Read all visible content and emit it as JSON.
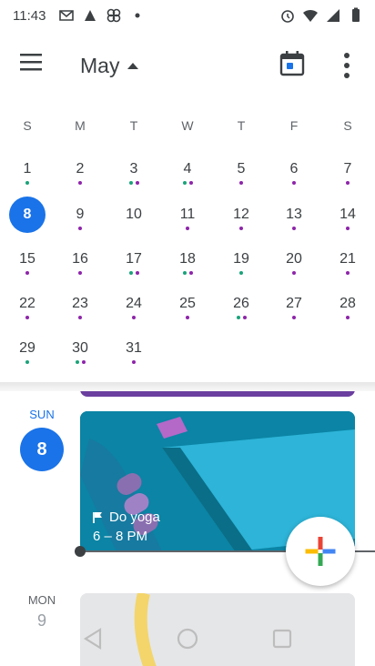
{
  "status_bar": {
    "time": "11:43",
    "left_icons": [
      "gmail-icon",
      "photos-icon",
      "pinwheel-icon",
      "dot-icon"
    ],
    "right_icons": [
      "alarm-icon",
      "wifi-icon",
      "signal-icon",
      "battery-icon"
    ]
  },
  "app_bar": {
    "month_label": "May",
    "menu_icon": "hamburger-menu-icon",
    "today_icon": "calendar-today-icon",
    "more_icon": "more-vert-icon"
  },
  "calendar": {
    "weekdays": [
      "S",
      "M",
      "T",
      "W",
      "T",
      "F",
      "S"
    ],
    "selected_day": "8",
    "weeks": [
      [
        {
          "n": "1",
          "dots": "g"
        },
        {
          "n": "2",
          "dots": "p"
        },
        {
          "n": "3",
          "dots": "gp"
        },
        {
          "n": "4",
          "dots": "gp"
        },
        {
          "n": "5",
          "dots": "p"
        },
        {
          "n": "6",
          "dots": "p"
        },
        {
          "n": "7",
          "dots": "p"
        }
      ],
      [
        {
          "n": "8",
          "dots": ""
        },
        {
          "n": "9",
          "dots": "p"
        },
        {
          "n": "10",
          "dots": ""
        },
        {
          "n": "11",
          "dots": "p"
        },
        {
          "n": "12",
          "dots": "p"
        },
        {
          "n": "13",
          "dots": "p"
        },
        {
          "n": "14",
          "dots": "p"
        }
      ],
      [
        {
          "n": "15",
          "dots": "p"
        },
        {
          "n": "16",
          "dots": "p"
        },
        {
          "n": "17",
          "dots": "gp"
        },
        {
          "n": "18",
          "dots": "gp"
        },
        {
          "n": "19",
          "dots": "g"
        },
        {
          "n": "20",
          "dots": "p"
        },
        {
          "n": "21",
          "dots": "p"
        }
      ],
      [
        {
          "n": "22",
          "dots": "p"
        },
        {
          "n": "23",
          "dots": "p"
        },
        {
          "n": "24",
          "dots": "p"
        },
        {
          "n": "25",
          "dots": "p"
        },
        {
          "n": "26",
          "dots": "gp"
        },
        {
          "n": "27",
          "dots": "p"
        },
        {
          "n": "28",
          "dots": "p"
        }
      ],
      [
        {
          "n": "29",
          "dots": "g"
        },
        {
          "n": "30",
          "dots": "gp"
        },
        {
          "n": "31",
          "dots": "p"
        }
      ]
    ]
  },
  "schedule": {
    "day_label": "SUN",
    "day_number": "8",
    "event": {
      "title": "Do yoga",
      "time": "6 – 8 PM",
      "flag_icon": "flag-icon"
    },
    "next_day_label": "MON",
    "next_day_number": "9"
  },
  "fab": {
    "icon": "plus-icon"
  },
  "nav": [
    "back-icon",
    "home-icon",
    "recents-icon"
  ]
}
